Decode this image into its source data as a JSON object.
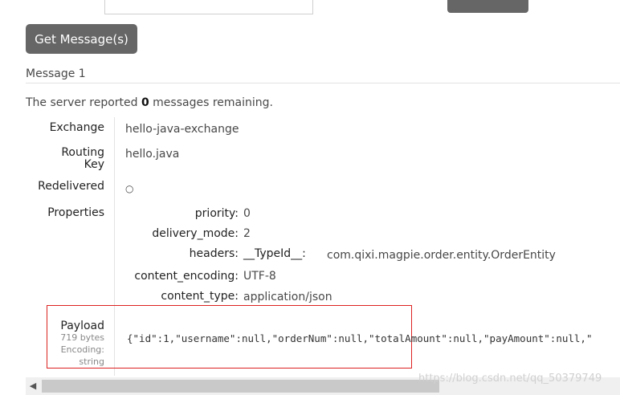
{
  "button": {
    "get_messages": "Get Message(s)"
  },
  "message": {
    "title": "Message 1",
    "remaining_prefix": "The server reported ",
    "remaining_count": "0",
    "remaining_suffix": " messages remaining."
  },
  "fields": {
    "exchange_label": "Exchange",
    "exchange_value": "hello-java-exchange",
    "routing_key_label_1": "Routing",
    "routing_key_label_2": "Key",
    "routing_key_value": "hello.java",
    "redelivered_label": "Redelivered",
    "redelivered_value": "○",
    "properties_label": "Properties"
  },
  "properties": {
    "priority_key": "priority:",
    "priority_value": "0",
    "delivery_mode_key": "delivery_mode:",
    "delivery_mode_value": "2",
    "headers_key": "headers:",
    "header_name": "__TypeId__:",
    "header_value": "com.qixi.magpie.order.entity.OrderEntity",
    "content_encoding_key": "content_encoding:",
    "content_encoding_value": "UTF-8",
    "content_type_key": "content_type:",
    "content_type_value": "application/json"
  },
  "payload": {
    "label": "Payload",
    "size": "719 bytes",
    "encoding_label": "Encoding:",
    "encoding_value": "string",
    "value": "{\"id\":1,\"username\":null,\"orderNum\":null,\"totalAmount\":null,\"payAmount\":null,\""
  },
  "scrollbar": {
    "left_arrow": "◀"
  },
  "watermark": "https://blog.csdn.net/qq_50379749",
  "colors": {
    "button_bg": "#666666",
    "highlight_border": "#dd2222",
    "text": "#484848"
  }
}
